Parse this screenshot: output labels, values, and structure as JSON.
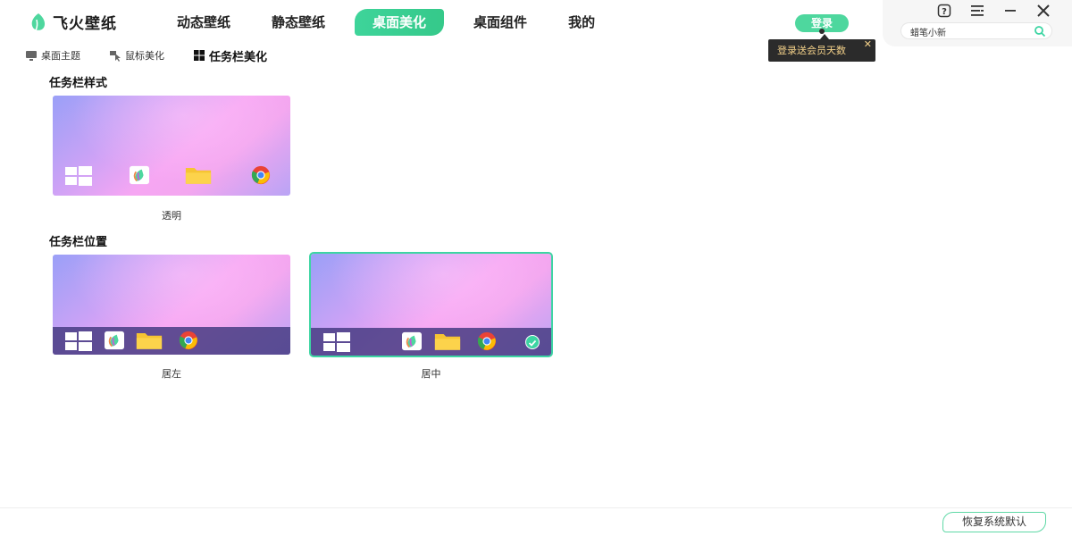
{
  "app": {
    "name": "飞火壁纸"
  },
  "nav": {
    "items": [
      {
        "label": "动态壁纸"
      },
      {
        "label": "静态壁纸"
      },
      {
        "label": "桌面美化"
      },
      {
        "label": "桌面组件"
      },
      {
        "label": "我的"
      }
    ],
    "active_index": 2
  },
  "login": {
    "label": "登录",
    "tooltip": "登录送会员天数",
    "tooltip_close": "✕"
  },
  "search": {
    "value": "蜡笔小新",
    "placeholder": ""
  },
  "subtabs": {
    "items": [
      {
        "label": "桌面主题",
        "icon": "monitor-icon"
      },
      {
        "label": "鼠标美化",
        "icon": "cursor-icon"
      },
      {
        "label": "任务栏美化",
        "icon": "windows-icon"
      }
    ],
    "active_index": 2
  },
  "sections": {
    "style": {
      "title": "任务栏样式",
      "options": [
        {
          "caption": "透明"
        }
      ]
    },
    "position": {
      "title": "任务栏位置",
      "options": [
        {
          "caption": "居左"
        },
        {
          "caption": "居中",
          "selected": true
        }
      ]
    }
  },
  "footer": {
    "restore_label": "恢复系统默认"
  },
  "colors": {
    "accent": "#3dd5a3",
    "taskbar": "#463c82",
    "tooltip_text": "#f5d28a"
  }
}
